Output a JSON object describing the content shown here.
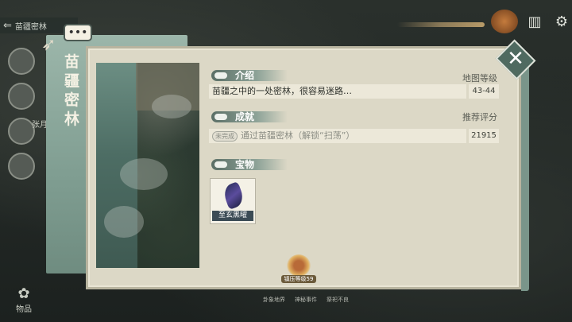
{
  "hud": {
    "location_label": "苗疆密林",
    "side_name": "张月",
    "bottom_left_label": "物品",
    "bottom_bar": [
      "卦象地界",
      "神秘事件",
      "祭祀不良"
    ]
  },
  "tab": {
    "title": "苗\n疆\n密\n林"
  },
  "panel": {
    "intro": {
      "header": "介绍",
      "text": "苗疆之中的一处密林，很容易迷路…",
      "map_level_label": "地图等级",
      "map_level_value": "43-44"
    },
    "achievement": {
      "header": "成就",
      "badge": "未完成",
      "text": "通过苗疆密林（解锁“扫荡”）",
      "score_label": "推荐评分",
      "score_value": "21915"
    },
    "treasure": {
      "header": "宝物",
      "items": [
        {
          "name": "至玄黑曜"
        }
      ]
    },
    "reward": {
      "label": "镇压等级59"
    }
  },
  "icons": {
    "close": "close-icon",
    "settings": "gear-icon",
    "back": "back-arrow-icon",
    "chat": "chat-icon"
  }
}
